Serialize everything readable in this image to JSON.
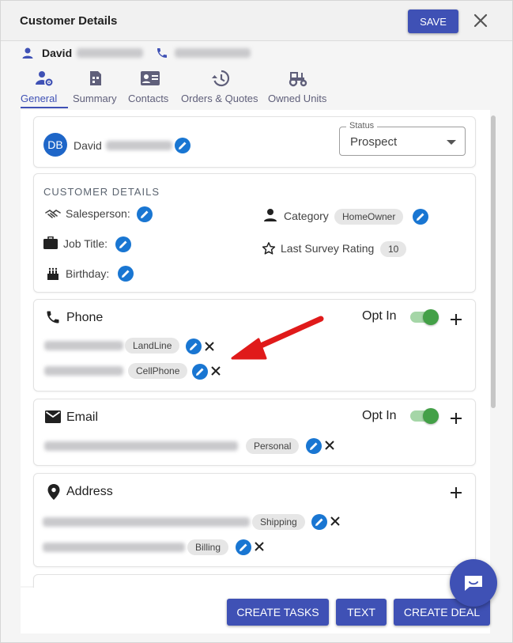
{
  "header": {
    "title": "Customer Details",
    "save_label": "SAVE"
  },
  "customer_bar": {
    "first_name": "David"
  },
  "tabs": [
    {
      "label": "General",
      "icon": "person-gear-icon",
      "active": true
    },
    {
      "label": "Summary",
      "icon": "document-icon",
      "active": false
    },
    {
      "label": "Contacts",
      "icon": "contact-card-icon",
      "active": false
    },
    {
      "label": "Orders & Quotes",
      "icon": "history-icon",
      "active": false
    },
    {
      "label": "Owned Units",
      "icon": "tractor-icon",
      "active": false
    }
  ],
  "profile": {
    "initials": "DB",
    "first_name": "David",
    "status": {
      "legend": "Status",
      "value": "Prospect"
    }
  },
  "customer_details": {
    "title": "CUSTOMER DETAILS",
    "salesperson_label": "Salesperson:",
    "job_title_label": "Job Title:",
    "birthday_label": "Birthday:",
    "category_label": "Category",
    "category_value": "HomeOwner",
    "survey_label": "Last Survey Rating",
    "survey_value": "10"
  },
  "phone": {
    "title": "Phone",
    "opt_in_label": "Opt In",
    "opt_in": true,
    "entries": [
      {
        "type": "LandLine"
      },
      {
        "type": "CellPhone"
      }
    ]
  },
  "email": {
    "title": "Email",
    "opt_in_label": "Opt In",
    "opt_in": true,
    "entries": [
      {
        "type": "Personal"
      }
    ]
  },
  "address": {
    "title": "Address",
    "entries": [
      {
        "type": "Shipping"
      },
      {
        "type": "Billing"
      }
    ]
  },
  "footer": {
    "create_tasks": "CREATE TASKS",
    "text": "TEXT",
    "create_deal": "CREATE DEAL"
  },
  "colors": {
    "primary": "#3f51b5",
    "pen_blue": "#1976d2",
    "toggle_green": "#43a047",
    "arrow_red": "#e01a1a"
  }
}
